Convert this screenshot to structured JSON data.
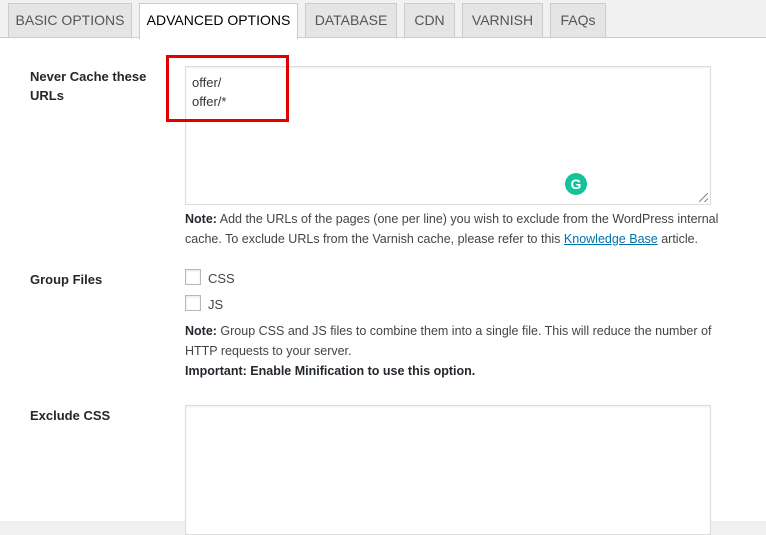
{
  "tabs": [
    {
      "label": "BASIC OPTIONS"
    },
    {
      "label": "ADVANCED OPTIONS"
    },
    {
      "label": "DATABASE"
    },
    {
      "label": "CDN"
    },
    {
      "label": "VARNISH"
    },
    {
      "label": "FAQs"
    }
  ],
  "active_tab": "ADVANCED OPTIONS",
  "never_cache": {
    "label_line1": "Never Cache these",
    "label_line2": "URLs",
    "value": "offer/\noffer/*",
    "note_bold": "Note:",
    "note_text1": " Add the URLs of the pages (one per line) you wish to exclude from the WordPress internal",
    "note_text2": "cache. To exclude URLs from the Varnish cache, please refer to this ",
    "note_link": "Knowledge Base",
    "note_text3": " article."
  },
  "grammarly": {
    "glyph": "G",
    "color": "#15c39a"
  },
  "group_files": {
    "label": "Group Files",
    "options": [
      {
        "label": "CSS",
        "checked": false
      },
      {
        "label": "JS",
        "checked": false
      }
    ],
    "note_bold": "Note:",
    "note_text1": " Group CSS and JS files to combine them into a single file. This will reduce the number of",
    "note_text2": "HTTP requests to your server.",
    "important": "Important: Enable Minification to use this option."
  },
  "exclude_css": {
    "label": "Exclude CSS",
    "value": ""
  },
  "colors": {
    "highlight": "#e30000",
    "link": "#0073aa"
  }
}
